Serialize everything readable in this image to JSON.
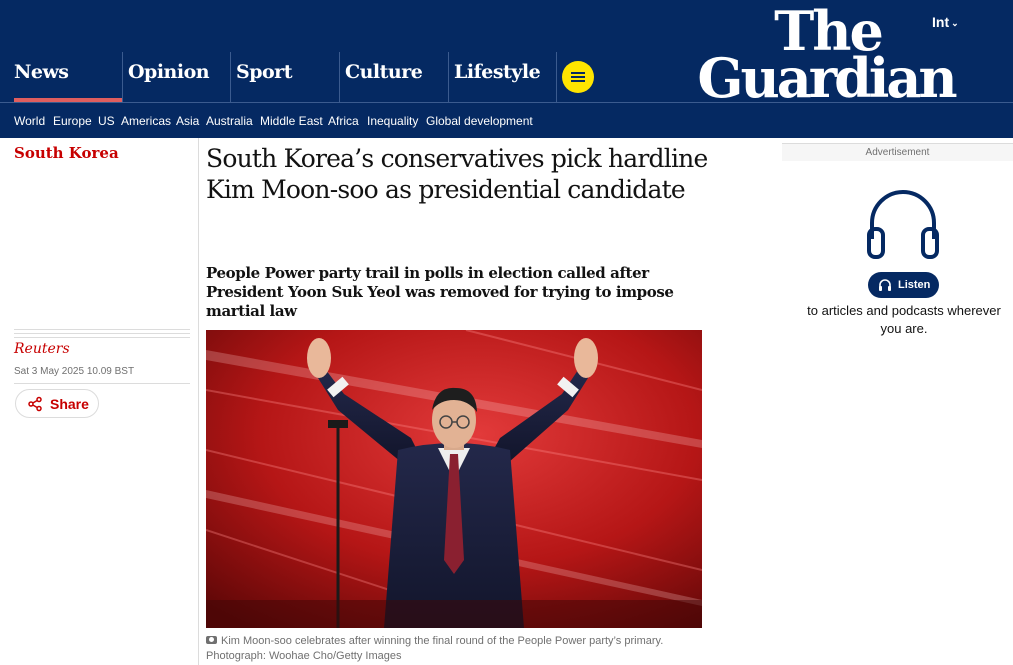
{
  "header": {
    "edition": "Int",
    "logo": {
      "line1": "The",
      "line2": "Guardian"
    },
    "pillars": [
      {
        "label": "News",
        "active": true
      },
      {
        "label": "Opinion",
        "active": false
      },
      {
        "label": "Sport",
        "active": false
      },
      {
        "label": "Culture",
        "active": false
      },
      {
        "label": "Lifestyle",
        "active": false
      }
    ],
    "subnav": [
      "World",
      "Europe",
      "US",
      "Americas",
      "Asia",
      "Australia",
      "Middle East",
      "Africa",
      "Inequality",
      "Global development"
    ],
    "colors": {
      "brand": "#052962",
      "menu_button": "#ffe500",
      "active_pillar": "#e05e5e"
    }
  },
  "article": {
    "section": "South Korea",
    "headline": "South Korea’s conservatives pick hardline Kim Moon-soo as presidential candidate",
    "standfirst": "People Power party trail in polls in election called after President Yoon Suk Yeol was removed for trying to impose martial law",
    "byline": "Reuters",
    "dateline": "Sat 3 May 2025 10.09 BST",
    "share_label": "Share",
    "caption": "Kim Moon-soo celebrates after winning the final round of the People Power party’s primary. Photograph: Woohae Cho/Getty Images"
  },
  "ad": {
    "label": "Advertisement",
    "button_label": "Listen",
    "copy": "to articles and podcasts wherever you are."
  },
  "icons": [
    "chevron-down-icon",
    "menu-icon",
    "share-icon",
    "camera-icon",
    "headphones-icon"
  ]
}
